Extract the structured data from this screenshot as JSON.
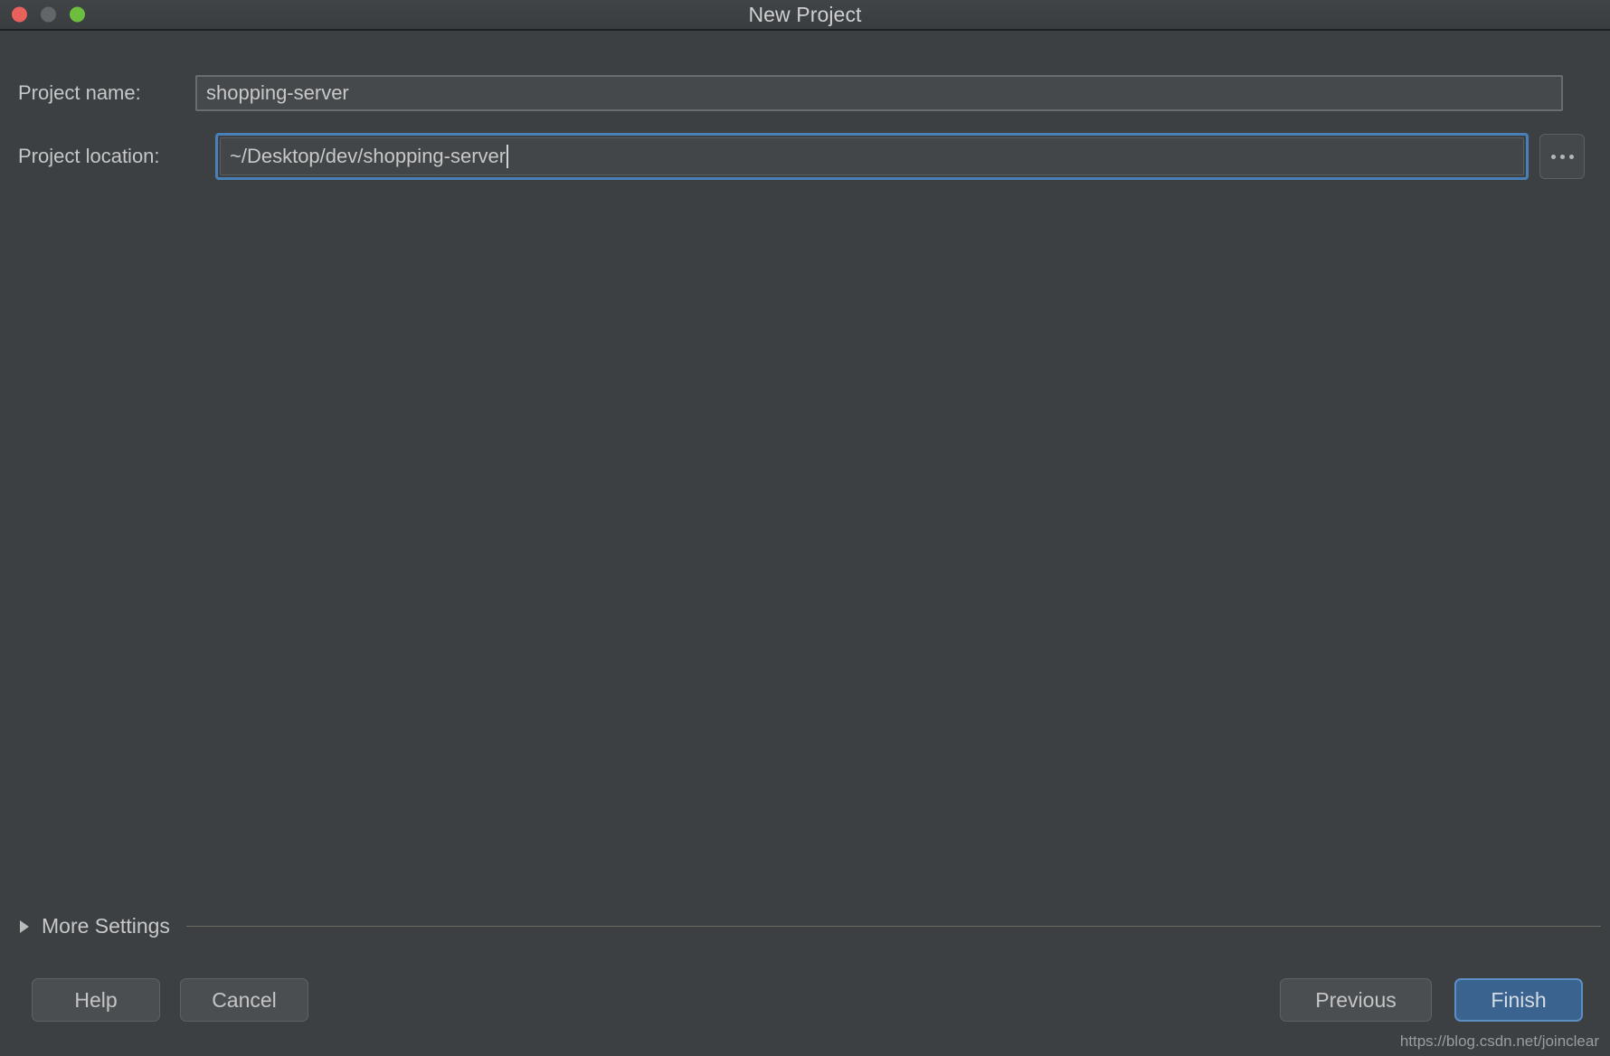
{
  "window": {
    "title": "New Project",
    "traffic_lights": [
      {
        "name": "close",
        "color": "#e8615a"
      },
      {
        "name": "minimize",
        "color": "#62666a"
      },
      {
        "name": "maximize",
        "color": "#6dbd3f"
      }
    ]
  },
  "form": {
    "project_name": {
      "label": "Project name:",
      "value": "shopping-server",
      "placeholder": "Project name"
    },
    "project_location": {
      "label": "Project location:",
      "value": "~/Desktop/dev/shopping-server",
      "placeholder": "Project location",
      "focused": true
    },
    "browse_button": {
      "label": "...",
      "icon": "ellipsis-icon"
    }
  },
  "more_settings": {
    "label": "More Settings",
    "expanded": false,
    "icon": "triangle-right-icon"
  },
  "footer": {
    "help_label": "Help",
    "cancel_label": "Cancel",
    "previous_label": "Previous",
    "finish_label": "Finish"
  },
  "watermark": {
    "text": "https://blog.csdn.net/joinclear"
  },
  "colors": {
    "window_background": "#3c4043",
    "titlebar_background": "#3e4245",
    "input_background": "#46494b",
    "input_border": "#6a6d6f",
    "focus_ring": "#4a80b8",
    "primary_button": "#3b6390",
    "primary_button_border": "#5d8fc4",
    "text": "#c8cacb",
    "separator": "#6c6b66"
  }
}
